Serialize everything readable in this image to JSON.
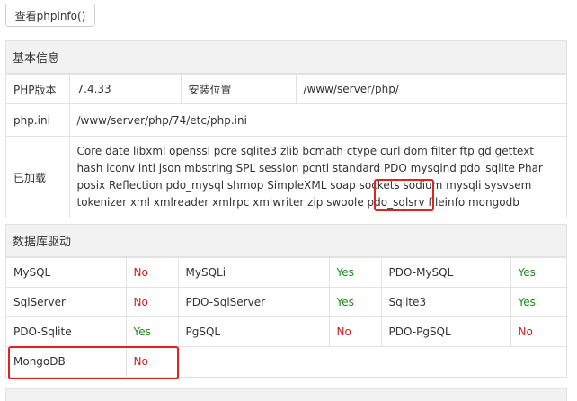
{
  "phpinfo_button": "查看phpinfo()",
  "basic": {
    "title": "基本信息",
    "php_version_label": "PHP版本",
    "php_version": "7.4.33",
    "install_label": "安装位置",
    "install_path": "/www/server/php/",
    "ini_label": "php.ini",
    "ini_path": "/www/server/php/74/etc/php.ini",
    "loaded_label": "已加载",
    "loaded_extensions": "Core date libxml openssl pcre sqlite3 zlib bcmath ctype curl dom filter ftp gd gettext hash iconv intl json mbstring SPL session pcntl standard PDO mysqlnd pdo_sqlite Phar posix Reflection pdo_mysql shmop SimpleXML soap sockets sodium mysqli sysvsem tokenizer xml xmlreader xmlrpc xmlwriter zip swoole pdo_sqlsrv fileinfo mongodb"
  },
  "drivers": {
    "title": "数据库驱动",
    "rows": [
      [
        {
          "name": "MySQL",
          "status": "No"
        },
        {
          "name": "MySQLi",
          "status": "Yes"
        },
        {
          "name": "PDO-MySQL",
          "status": "Yes"
        }
      ],
      [
        {
          "name": "SqlServer",
          "status": "No"
        },
        {
          "name": "PDO-SqlServer",
          "status": "Yes"
        },
        {
          "name": "Sqlite3",
          "status": "Yes"
        }
      ],
      [
        {
          "name": "PDO-Sqlite",
          "status": "Yes"
        },
        {
          "name": "PgSQL",
          "status": "No"
        },
        {
          "name": "PDO-PgSQL",
          "status": "No"
        }
      ],
      [
        {
          "name": "MongoDB",
          "status": "No"
        }
      ]
    ]
  },
  "colors": {
    "yes": "#1a8a1a",
    "no": "#cc2020",
    "highlight": "#e02222"
  }
}
